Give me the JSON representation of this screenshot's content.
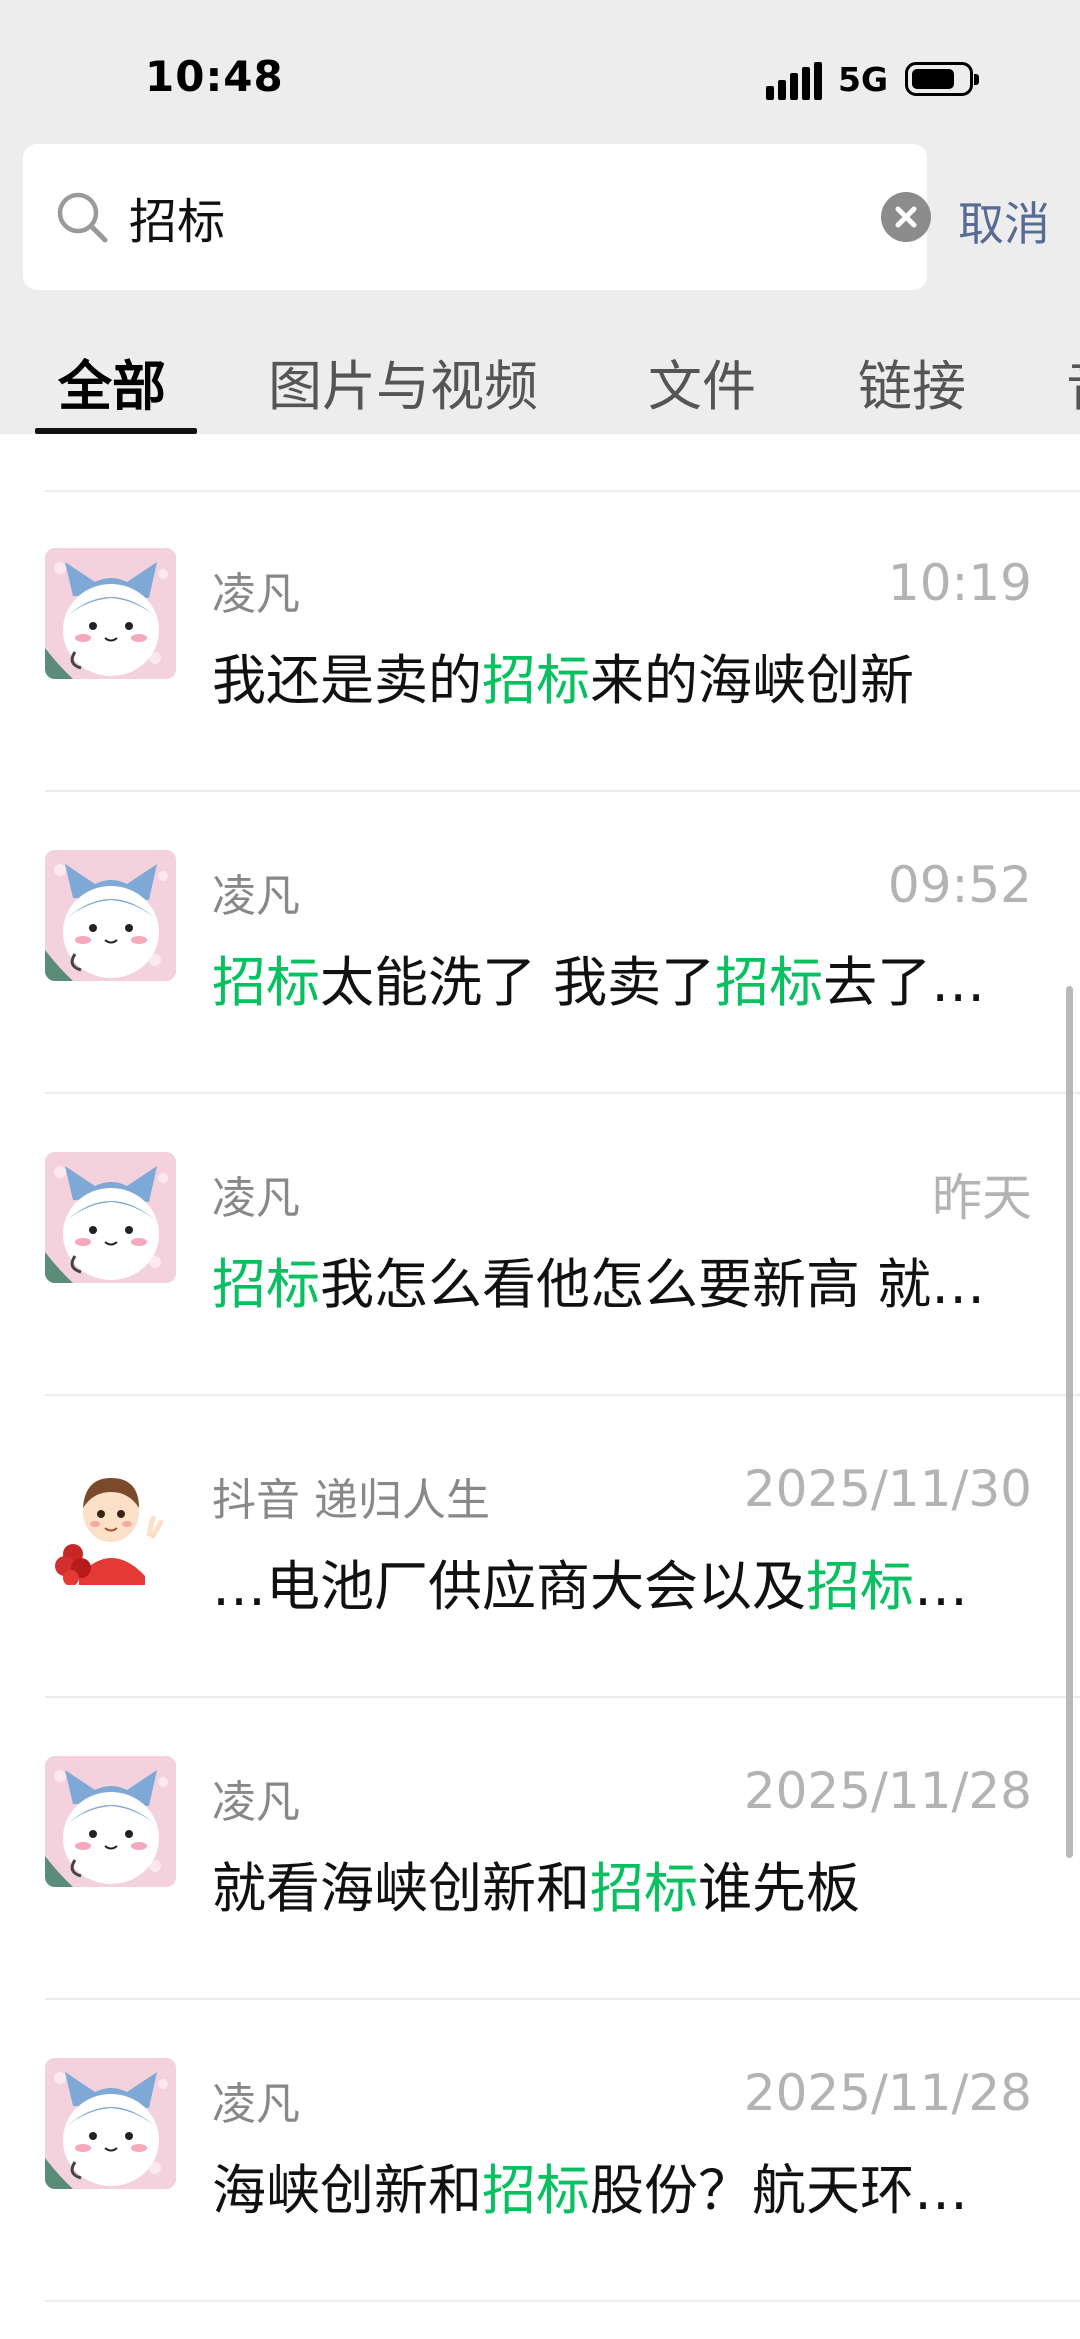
{
  "status_bar": {
    "time": "10:48",
    "network": "5G"
  },
  "search": {
    "value": "招标",
    "cancel_label": "取消"
  },
  "tabs": [
    {
      "label": "全部"
    },
    {
      "label": "图片与视频"
    },
    {
      "label": "文件"
    },
    {
      "label": "链接"
    },
    {
      "label": "音"
    }
  ],
  "colors": {
    "highlight": "#07c160",
    "cancel": "#576b95",
    "header_bg": "#ededed"
  },
  "results": [
    {
      "name": "凌凡",
      "time": "10:19",
      "avatar": "cat-avatar",
      "message": [
        {
          "t": "我还是卖的"
        },
        {
          "t": "招标",
          "hl": true
        },
        {
          "t": "来的海峡创新"
        }
      ]
    },
    {
      "name": "凌凡",
      "time": "09:52",
      "avatar": "cat-avatar",
      "message": [
        {
          "t": "招标",
          "hl": true
        },
        {
          "t": "太能洗了 我卖了"
        },
        {
          "t": "招标",
          "hl": true
        },
        {
          "t": "去了…"
        }
      ]
    },
    {
      "name": "凌凡",
      "time": "昨天",
      "avatar": "cat-avatar",
      "message": [
        {
          "t": "招标",
          "hl": true
        },
        {
          "t": "我怎么看他怎么要新高 就…"
        }
      ]
    },
    {
      "name": "抖音 递归人生",
      "time": "2025/11/30",
      "avatar": "boy-avatar",
      "message": [
        {
          "t": "…电池厂供应商大会以及"
        },
        {
          "t": "招标",
          "hl": true
        },
        {
          "t": "…"
        }
      ]
    },
    {
      "name": "凌凡",
      "time": "2025/11/28",
      "avatar": "cat-avatar",
      "message": [
        {
          "t": "就看海峡创新和"
        },
        {
          "t": "招标",
          "hl": true
        },
        {
          "t": "谁先板"
        }
      ]
    },
    {
      "name": "凌凡",
      "time": "2025/11/28",
      "avatar": "cat-avatar",
      "message": [
        {
          "t": "海峡创新和"
        },
        {
          "t": "招标",
          "hl": true
        },
        {
          "t": "股份？航天环…"
        }
      ]
    }
  ]
}
